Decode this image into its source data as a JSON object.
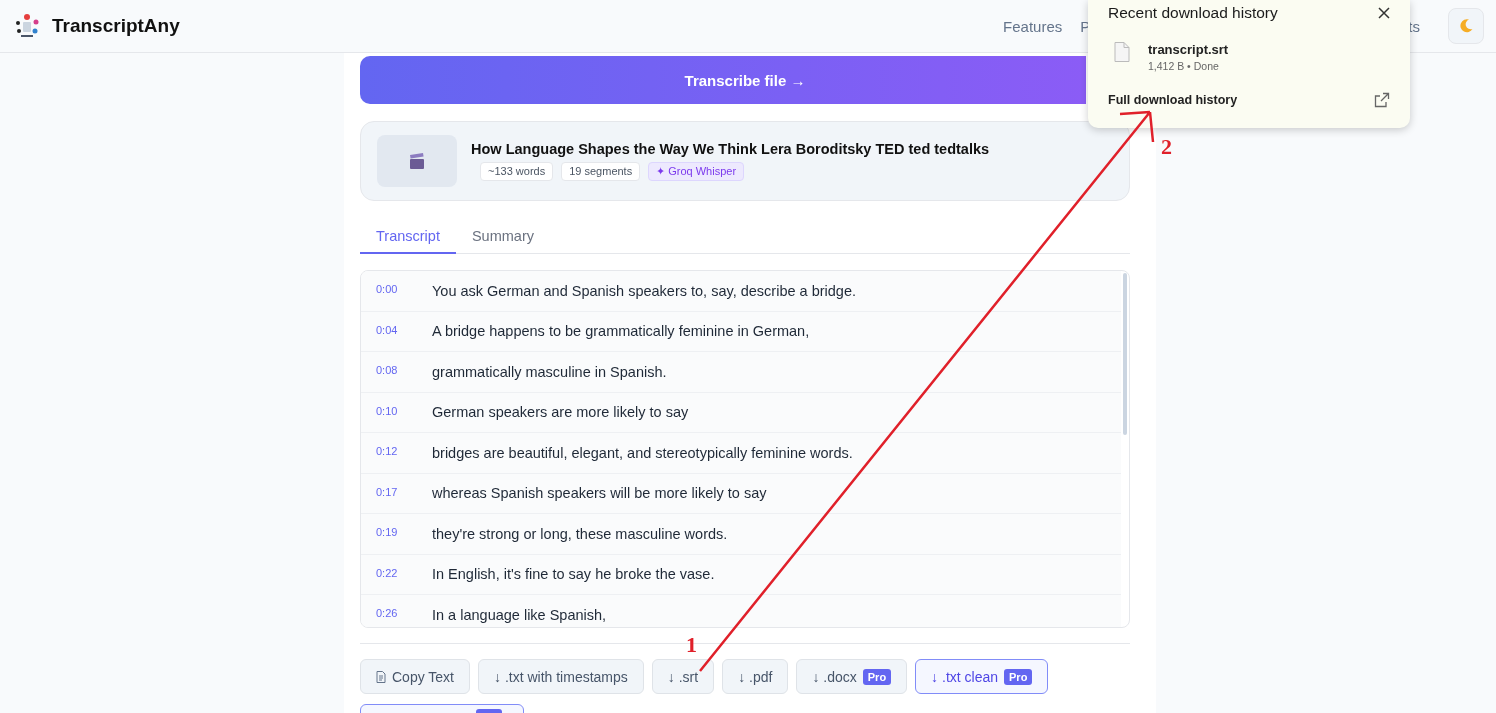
{
  "header": {
    "brand": "TranscriptAny",
    "nav": [
      "Features",
      "P",
      "ts"
    ]
  },
  "transcribe_button": "Transcribe file →",
  "file": {
    "title": "How Language Shapes the Way We Think Lera Boroditsky TED ted tedtalks",
    "badges": [
      {
        "text": "~133 words",
        "kind": "plain"
      },
      {
        "text": "19 segments",
        "kind": "plain"
      },
      {
        "text": "✦ Groq Whisper",
        "kind": "engine"
      }
    ]
  },
  "tabs": [
    {
      "label": "Transcript",
      "selected": true
    },
    {
      "label": "Summary",
      "selected": false
    }
  ],
  "segments": [
    {
      "time": "0:00",
      "text": "You ask German and Spanish speakers to, say, describe a bridge."
    },
    {
      "time": "0:04",
      "text": "A bridge happens to be grammatically feminine in German,"
    },
    {
      "time": "0:08",
      "text": "grammatically masculine in Spanish."
    },
    {
      "time": "0:10",
      "text": "German speakers are more likely to say"
    },
    {
      "time": "0:12",
      "text": "bridges are beautiful, elegant, and stereotypically feminine words."
    },
    {
      "time": "0:17",
      "text": "whereas Spanish speakers will be more likely to say"
    },
    {
      "time": "0:19",
      "text": "they're strong or long, these masculine words."
    },
    {
      "time": "0:22",
      "text": "In English, it's fine to say he broke the vase."
    },
    {
      "time": "0:26",
      "text": "In a language like Spanish,"
    }
  ],
  "actions": [
    {
      "kind": "copy",
      "label": "Copy Text",
      "highlighted": false
    },
    {
      "kind": "download",
      "label": "↓ .txt with timestamps",
      "highlighted": false
    },
    {
      "kind": "download",
      "label": "↓ .srt",
      "highlighted": false
    },
    {
      "kind": "download",
      "label": "↓ .pdf",
      "highlighted": false
    },
    {
      "kind": "download",
      "label": "↓ .docx",
      "badge": "Pro",
      "highlighted": false
    },
    {
      "kind": "download",
      "label": "↓ .txt clean",
      "badge": "Pro",
      "highlighted": true
    },
    {
      "kind": "partial",
      "highlighted": true
    }
  ],
  "download_popup": {
    "title": "Recent download history",
    "files": [
      {
        "name": "transcript.srt",
        "meta": "1,412 B • Done"
      }
    ],
    "footer_link": "Full download history"
  },
  "annotations": [
    {
      "label": "1"
    },
    {
      "label": "2"
    }
  ]
}
